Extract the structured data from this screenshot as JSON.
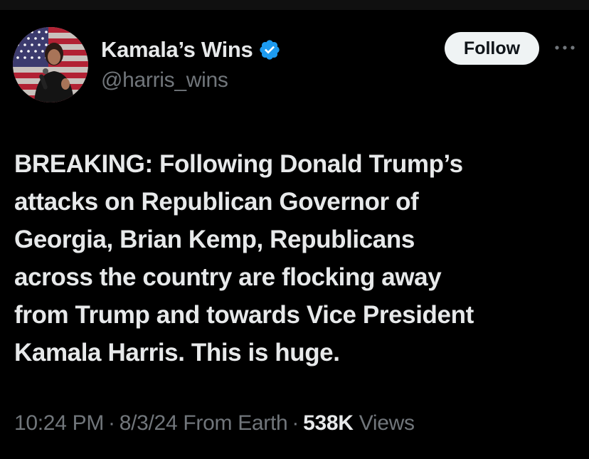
{
  "author": {
    "display_name": "Kamala’s Wins",
    "handle": "@harris_wins",
    "verified": true,
    "avatar_icon": "profile-photo-flag-background"
  },
  "actions": {
    "follow_label": "Follow",
    "more_icon": "ellipsis-icon"
  },
  "tweet": {
    "text_lines": [
      "BREAKING: Following Donald Trump’s",
      "attacks on Republican Governor of",
      "Georgia, Brian Kemp, Republicans",
      "across the country are flocking away",
      "from Trump and towards Vice President",
      "Kamala Harris. This is huge."
    ]
  },
  "meta": {
    "time": "10:24 PM",
    "separator": "·",
    "date": "8/3/24",
    "source": "From Earth",
    "views_count": "538K",
    "views_label": "Views"
  },
  "colors": {
    "background": "#000000",
    "primary_text": "#e7e9ea",
    "secondary_text": "#71767b",
    "verified_blue": "#1d9bf0",
    "follow_button_bg": "#eff3f4"
  }
}
